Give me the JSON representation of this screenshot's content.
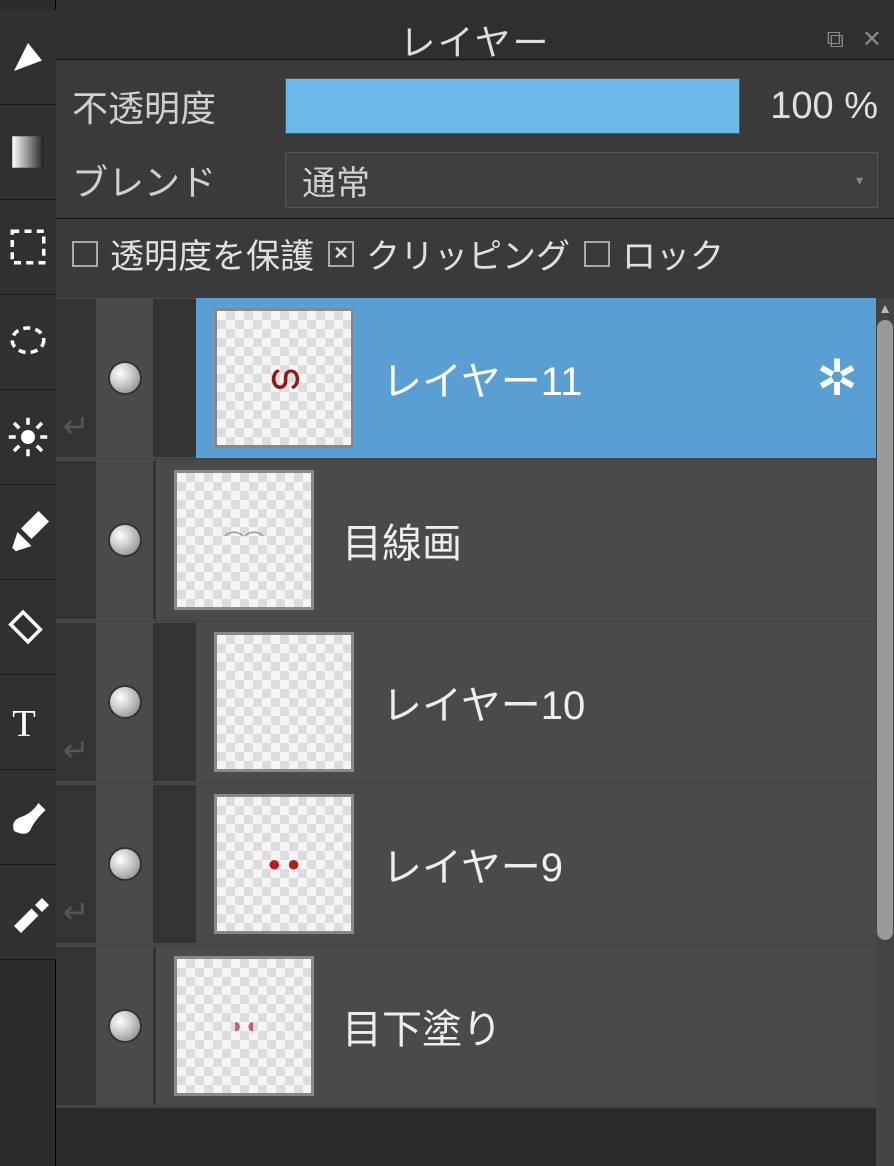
{
  "panel": {
    "title": "レイヤー"
  },
  "opacity": {
    "label": "不透明度",
    "percent": 100,
    "display": "100 %"
  },
  "blend": {
    "label": "ブレンド",
    "value": "通常"
  },
  "checks": {
    "protect_opacity": {
      "label": "透明度を保護",
      "checked": false
    },
    "clipping": {
      "label": "クリッピング",
      "checked": true
    },
    "lock": {
      "label": "ロック",
      "checked": false
    }
  },
  "layers": [
    {
      "name": "レイヤー11",
      "selected": true,
      "clipped": true,
      "gear": true
    },
    {
      "name": "目線画",
      "selected": false,
      "clipped": false,
      "gear": false
    },
    {
      "name": "レイヤー10",
      "selected": false,
      "clipped": true,
      "gear": false
    },
    {
      "name": "レイヤー9",
      "selected": false,
      "clipped": true,
      "gear": false
    },
    {
      "name": "目下塗り",
      "selected": false,
      "clipped": false,
      "gear": false
    }
  ]
}
